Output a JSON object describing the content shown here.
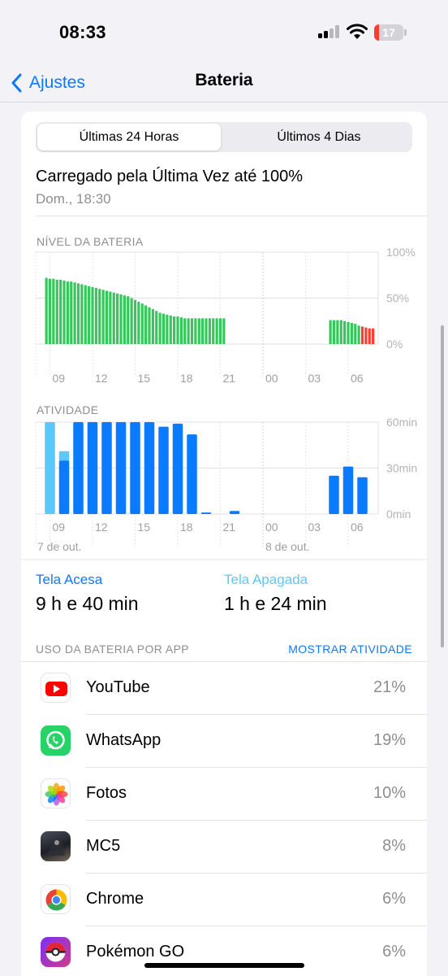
{
  "status": {
    "time": "08:33",
    "battery_level": "17"
  },
  "nav": {
    "back_label": "Ajustes",
    "title": "Bateria"
  },
  "segments": {
    "active": "Últimas 24 Horas",
    "inactive": "Últimos 4 Dias"
  },
  "last_charge": {
    "title": "Carregado pela Última Vez até 100%",
    "date": "Dom., 18:30"
  },
  "battery_chart": {
    "label": "NÍVEL DA BATERIA",
    "y_labels": [
      "100%",
      "50%",
      "0%"
    ],
    "x_labels": [
      "09",
      "12",
      "15",
      "18",
      "21",
      "00",
      "03",
      "06"
    ]
  },
  "activity_chart": {
    "label": "ATIVIDADE",
    "y_labels": [
      "60min",
      "30min",
      "0min"
    ],
    "x_labels": [
      "09",
      "12",
      "15",
      "18",
      "21",
      "00",
      "03",
      "06"
    ],
    "date_labels": [
      "7 de out.",
      "8 de out."
    ]
  },
  "chart_data": [
    {
      "type": "bar",
      "title": "NÍVEL DA BATERIA",
      "x_unit": "hour of day, 7–8 Oct",
      "y_unit": "%",
      "ylim": [
        0,
        100
      ],
      "x_ticks": [
        "09",
        "12",
        "15",
        "18",
        "21",
        "00",
        "03",
        "06"
      ],
      "series": [
        {
          "x": [
            8.75,
            9.0,
            9.25,
            9.5,
            9.75,
            10.0,
            10.25,
            10.5,
            10.75,
            11.0,
            11.25,
            11.5,
            11.75,
            12.0,
            12.25,
            12.5,
            12.75,
            13.0,
            13.25,
            13.5,
            13.75,
            14.0,
            14.25,
            14.5,
            14.75,
            15.0,
            15.25,
            15.5,
            15.75,
            16.0,
            16.25,
            16.5,
            16.75,
            17.0,
            17.25,
            17.5,
            17.75,
            18.0,
            18.25,
            18.5,
            18.75,
            19.0,
            19.25,
            19.5,
            19.75,
            20.0,
            20.25,
            20.5,
            20.75,
            21.0,
            21.25
          ],
          "values": [
            72,
            71,
            71,
            70,
            70,
            69,
            68,
            68,
            67,
            66,
            65,
            64,
            63,
            62,
            61,
            60,
            59,
            58,
            57,
            56,
            55,
            54,
            53,
            52,
            50,
            48,
            46,
            44,
            42,
            40,
            38,
            36,
            34,
            33,
            32,
            31,
            30,
            30,
            29,
            28,
            28,
            28,
            28,
            28,
            28,
            28,
            28,
            28,
            28,
            28,
            28
          ]
        },
        {
          "x": [
            4.75,
            5.0,
            5.25,
            5.5,
            5.75,
            6.0,
            6.25,
            6.5,
            6.75,
            7.0,
            7.25,
            7.5,
            7.75
          ],
          "values": [
            26,
            26,
            26,
            26,
            25,
            24,
            23,
            22,
            20,
            19,
            18,
            17,
            17
          ],
          "low_battery_from_x": 7.0
        }
      ],
      "colors": {
        "normal": "#34c759",
        "low": "#ff3b30"
      }
    },
    {
      "type": "bar",
      "title": "ATIVIDADE",
      "x_unit": "hour of day, 7–8 Oct",
      "y_unit": "min",
      "ylim": [
        0,
        60
      ],
      "x_ticks": [
        "09",
        "12",
        "15",
        "18",
        "21",
        "00",
        "03",
        "06"
      ],
      "hours": [
        "09",
        "10",
        "11",
        "12",
        "13",
        "14",
        "15",
        "16",
        "17",
        "18",
        "19",
        "20",
        "21",
        "22",
        "23",
        "00",
        "01",
        "02",
        "03",
        "04",
        "05",
        "06",
        "07"
      ],
      "series": [
        {
          "name": "Tela Acesa",
          "values": [
            0,
            35,
            60,
            60,
            60,
            60,
            60,
            60,
            57,
            59,
            52,
            1,
            0,
            2,
            0,
            0,
            0,
            0,
            0,
            0,
            25,
            31,
            24
          ]
        },
        {
          "name": "Tela Apagada",
          "values": [
            60,
            6,
            0,
            0,
            0,
            0,
            0,
            0,
            0,
            0,
            0,
            0,
            0,
            0,
            0,
            0,
            0,
            0,
            0,
            0,
            0,
            0,
            0
          ]
        }
      ],
      "colors": {
        "screen_on": "#0a7aff",
        "screen_off": "#5ac8fa"
      }
    }
  ],
  "summary": {
    "on": {
      "label": "Tela Acesa",
      "value": "9 h e 40 min",
      "color": "#0a7aff"
    },
    "off": {
      "label": "Tela Apagada",
      "value": "1 h e 24 min",
      "color": "#5ac8fa"
    }
  },
  "usage": {
    "header": "USO DA BATERIA POR APP",
    "action": "MOSTRAR ATIVIDADE",
    "apps": [
      {
        "name": "YouTube",
        "percent": "21%",
        "icon": "youtube-icon"
      },
      {
        "name": "WhatsApp",
        "percent": "19%",
        "icon": "whatsapp-icon"
      },
      {
        "name": "Fotos",
        "percent": "10%",
        "icon": "photos-icon"
      },
      {
        "name": "MC5",
        "percent": "8%",
        "icon": "mc5-icon"
      },
      {
        "name": "Chrome",
        "percent": "6%",
        "icon": "chrome-icon"
      },
      {
        "name": "Pokémon GO",
        "percent": "6%",
        "icon": "pokemon-go-icon"
      }
    ]
  }
}
